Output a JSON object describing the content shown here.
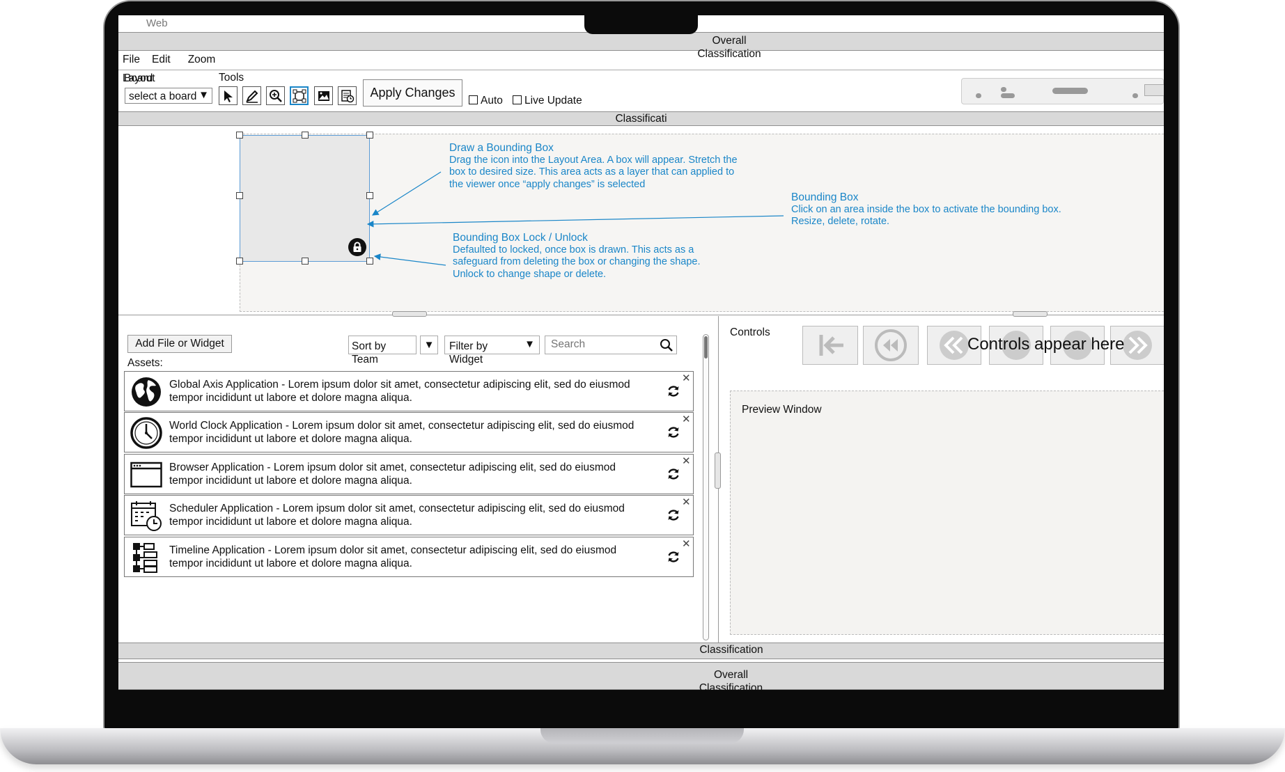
{
  "window": {
    "title": "Web Browser",
    "classification_top": "Overall Classification"
  },
  "menu": {
    "items": [
      "File",
      "Edit",
      "Zoom"
    ]
  },
  "toolbar": {
    "layout_label": "Layout",
    "board_label": "Board",
    "board_select": "select a board",
    "tools_label": "Tools",
    "apply_button": "Apply Changes",
    "auto_label": "Auto",
    "live_update_label": "Live Update"
  },
  "classification_bar": "Classificati",
  "layout_area": {
    "annotations": {
      "draw": {
        "title": "Draw a Bounding Box",
        "body": "Drag the icon into the Layout Area. A box will appear. Stretch the box  to desired size. This area acts as a layer that can applied to the viewer once “apply changes” is selected"
      },
      "bbox": {
        "title": "Bounding Box",
        "body": "Click on an area inside the box to activate the bounding box. Resize, delete, rotate."
      },
      "lock": {
        "title": "Bounding Box Lock / Unlock",
        "body": "Defaulted to locked, once box is drawn. This acts as a safeguard from deleting the box or changing the shape. Unlock to change shape or delete."
      }
    }
  },
  "assets_panel": {
    "add_button": "Add  File or Widget",
    "assets_label": "Assets:",
    "sort": "Sort by Team",
    "filter": "Filter by Widget",
    "search_placeholder": "Search",
    "items": [
      {
        "icon": "globe-icon",
        "text": "Global Axis Application - Lorem ipsum dolor sit amet, consectetur adipiscing elit, sed do eiusmod tempor incididunt ut labore et dolore magna aliqua."
      },
      {
        "icon": "clock-icon",
        "text": "World Clock Application - Lorem ipsum dolor sit amet, consectetur adipiscing elit, sed do eiusmod tempor incididunt ut labore et dolore magna aliqua."
      },
      {
        "icon": "browser-window-icon",
        "text": "Browser Application - Lorem ipsum dolor sit amet, consectetur adipiscing elit, sed do eiusmod tempor incididunt ut labore et dolore magna aliqua."
      },
      {
        "icon": "calendar-clock-icon",
        "text": "Scheduler Application - Lorem ipsum dolor sit amet, consectetur adipiscing elit, sed do eiusmod tempor incididunt ut labore et dolore magna aliqua."
      },
      {
        "icon": "timeline-icon",
        "text": "Timeline Application - Lorem ipsum dolor sit amet, consectetur adipiscing elit, sed do eiusmod tempor incididunt ut labore et dolore magna aliqua."
      }
    ]
  },
  "controls_panel": {
    "label": "Controls",
    "overlay_text": "Controls appear here",
    "preview_label": "Preview Window"
  },
  "footer": {
    "classification": "Classification",
    "overall": "Overall Classification"
  }
}
